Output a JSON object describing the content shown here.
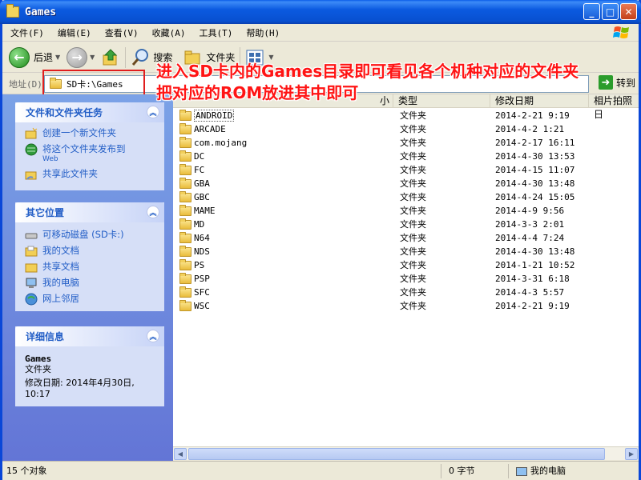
{
  "window": {
    "title": "Games"
  },
  "menu": [
    "文件(F)",
    "编辑(E)",
    "查看(V)",
    "收藏(A)",
    "工具(T)",
    "帮助(H)"
  ],
  "toolbar": {
    "back": "后退",
    "search": "搜索",
    "folders": "文件夹"
  },
  "address": {
    "label": "地址(D)",
    "value": "SD卡:\\Games",
    "go": "转到"
  },
  "annotation": {
    "line1": "进入SD卡内的Games目录即可看见各个机种对应的文件夹",
    "line2": "把对应的ROM放进其中即可"
  },
  "tasks": {
    "title": "文件和文件夹任务",
    "items": [
      "创建一个新文件夹",
      "将这个文件夹发布到",
      "共享此文件夹"
    ],
    "web_suffix": "Web"
  },
  "places": {
    "title": "其它位置",
    "items": [
      "可移动磁盘 (SD卡:)",
      "我的文档",
      "共享文档",
      "我的电脑",
      "网上邻居"
    ]
  },
  "details": {
    "title": "详细信息",
    "name": "Games",
    "type": "文件夹",
    "modified_line1": "修改日期: 2014年4月30日,",
    "modified_line2": "10:17"
  },
  "columns": {
    "size_tail": "小",
    "type": "类型",
    "modified": "修改日期",
    "photo": "相片拍照日"
  },
  "files": [
    {
      "name": "ANDROID",
      "type": "文件夹",
      "date": "2014-2-21 9:19"
    },
    {
      "name": "ARCADE",
      "type": "文件夹",
      "date": "2014-4-2 1:21"
    },
    {
      "name": "com.mojang",
      "type": "文件夹",
      "date": "2014-2-17 16:11"
    },
    {
      "name": "DC",
      "type": "文件夹",
      "date": "2014-4-30 13:53"
    },
    {
      "name": "FC",
      "type": "文件夹",
      "date": "2014-4-15 11:07"
    },
    {
      "name": "GBA",
      "type": "文件夹",
      "date": "2014-4-30 13:48"
    },
    {
      "name": "GBC",
      "type": "文件夹",
      "date": "2014-4-24 15:05"
    },
    {
      "name": "MAME",
      "type": "文件夹",
      "date": "2014-4-9 9:56"
    },
    {
      "name": "MD",
      "type": "文件夹",
      "date": "2014-3-3 2:01"
    },
    {
      "name": "N64",
      "type": "文件夹",
      "date": "2014-4-4 7:24"
    },
    {
      "name": "NDS",
      "type": "文件夹",
      "date": "2014-4-30 13:48"
    },
    {
      "name": "PS",
      "type": "文件夹",
      "date": "2014-1-21 10:52"
    },
    {
      "name": "PSP",
      "type": "文件夹",
      "date": "2014-3-31 6:18"
    },
    {
      "name": "SFC",
      "type": "文件夹",
      "date": "2014-4-3 5:57"
    },
    {
      "name": "WSC",
      "type": "文件夹",
      "date": "2014-2-21 9:19"
    }
  ],
  "status": {
    "count": "15 个对象",
    "size": "0 字节",
    "location": "我的电脑"
  },
  "colors": {
    "title_blue": "#0a5ee8",
    "task_link": "#215dc6",
    "annotation_red": "#ff1414",
    "highlight_red": "#e01e1e"
  }
}
